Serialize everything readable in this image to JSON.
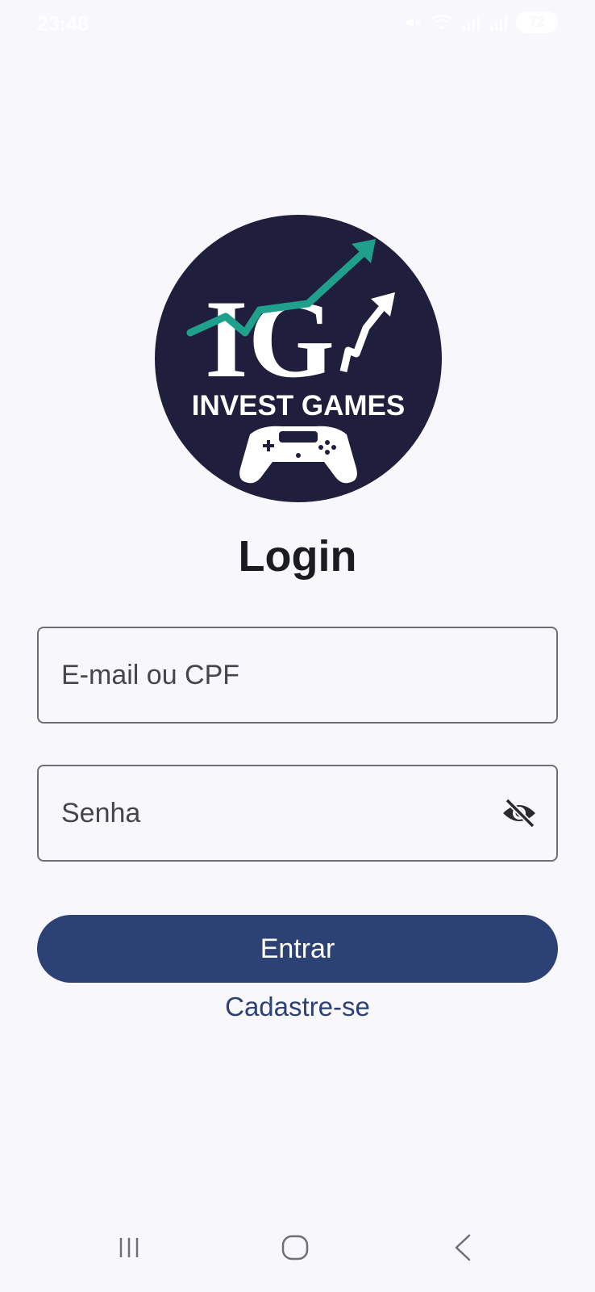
{
  "status_bar": {
    "time": "23:48",
    "battery": "72",
    "icons": [
      "mute-icon",
      "wifi-icon",
      "signal-icon",
      "signal-icon",
      "battery-icon"
    ]
  },
  "logo": {
    "monogram": "IG",
    "brand_name": "INVEST GAMES",
    "circle_color": "#1f1e3c",
    "arrow_color": "#1fa08c"
  },
  "login": {
    "title": "Login",
    "email_placeholder": "E-mail ou CPF",
    "password_placeholder": "Senha",
    "password_toggle_icon": "eye-off-icon",
    "submit_label": "Entrar",
    "signup_label": "Cadastre-se"
  },
  "colors": {
    "background": "#f8f7fc",
    "primary": "#2c4174",
    "text": "#1b1b22",
    "border": "#6f6f78"
  },
  "nav_bar": {
    "icons": [
      "recent-apps-icon",
      "home-icon",
      "back-icon"
    ]
  }
}
